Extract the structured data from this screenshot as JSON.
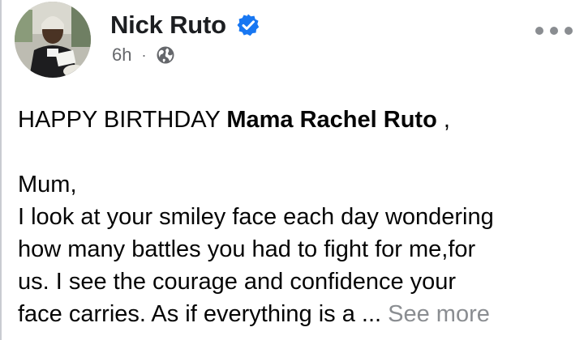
{
  "post": {
    "author": {
      "name": "Nick Ruto",
      "verified": true,
      "avatar_icon": "profile-photo"
    },
    "meta": {
      "time": "6h",
      "separator": "·",
      "audience_icon": "globe-icon"
    },
    "more_icon": "ellipsis-icon",
    "text": {
      "greeting_prefix": "HAPPY BIRTHDAY ",
      "greeting_name": "Mama Rachel Ruto",
      "greeting_suffix": " ,",
      "salutation": "Mum,",
      "lines": [
        "I look at your smiley face each day wondering",
        "how many battles you had to fight for me,for",
        "us. I see the courage and confidence your"
      ],
      "last_line": "face carries. As if everything is a ...",
      "see_more": "See more"
    }
  },
  "colors": {
    "verified_blue": "#1877f2",
    "meta_gray": "#65676b",
    "see_more_gray": "#8a8d91"
  }
}
